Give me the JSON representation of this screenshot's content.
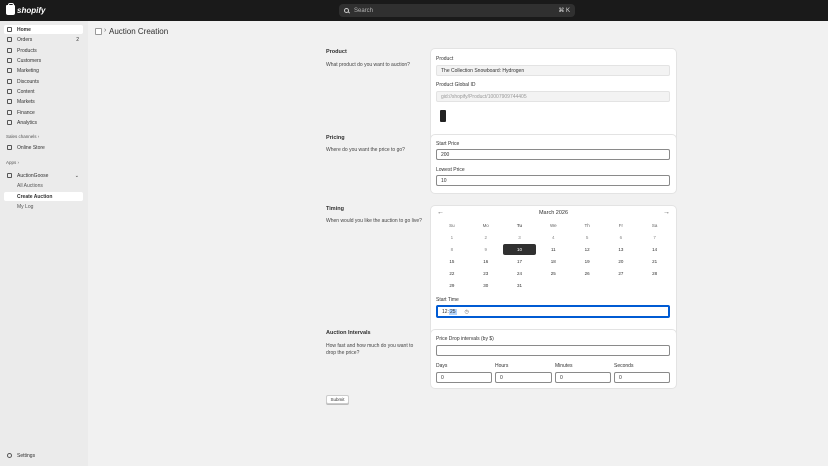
{
  "topbar": {
    "logo_text": "shopify",
    "search_placeholder": "Search",
    "shortcut": "⌘ K"
  },
  "sidebar": {
    "items": [
      {
        "label": "Home",
        "icon": "home-icon"
      },
      {
        "label": "Orders",
        "icon": "orders-icon",
        "badge": "2"
      },
      {
        "label": "Products",
        "icon": "products-icon"
      },
      {
        "label": "Customers",
        "icon": "customers-icon"
      },
      {
        "label": "Marketing",
        "icon": "marketing-icon"
      },
      {
        "label": "Discounts",
        "icon": "discounts-icon"
      },
      {
        "label": "Content",
        "icon": "content-icon"
      },
      {
        "label": "Markets",
        "icon": "markets-icon"
      },
      {
        "label": "Finance",
        "icon": "finance-icon"
      },
      {
        "label": "Analytics",
        "icon": "analytics-icon"
      }
    ],
    "sales_channels_label": "Sales channels",
    "online_store_label": "Online Store",
    "apps_label": "Apps",
    "app_name": "AuctionGoose",
    "app_subitems": [
      "All Auctions",
      "Create Auction",
      "My Log"
    ],
    "settings_label": "Settings"
  },
  "page": {
    "title": "Auction Creation"
  },
  "product_section": {
    "heading": "Product",
    "description": "What product do you want to auction?",
    "product_label": "Product",
    "product_value": "The Collection Snowboard: Hydrogen",
    "gid_label": "Product Global ID",
    "gid_value": "gid://shopify/Product/10007909744405"
  },
  "pricing_section": {
    "heading": "Pricing",
    "description": "Where do you want the price to go?",
    "start_label": "Start Price",
    "start_value": "200",
    "lowest_label": "Lowest Price",
    "lowest_value": "10"
  },
  "timing_section": {
    "heading": "Timing",
    "description": "When would you like the auction to go live?",
    "month": "March 2026",
    "weekdays": [
      "Su",
      "Mo",
      "Tu",
      "We",
      "Th",
      "Fr",
      "Sa"
    ],
    "weeks": [
      [
        "1",
        "2",
        "3",
        "4",
        "5",
        "6",
        "7"
      ],
      [
        "8",
        "9",
        "10",
        "11",
        "12",
        "13",
        "14"
      ],
      [
        "15",
        "16",
        "17",
        "18",
        "19",
        "20",
        "21"
      ],
      [
        "22",
        "23",
        "24",
        "25",
        "26",
        "27",
        "28"
      ],
      [
        "29",
        "30",
        "31",
        "",
        "",
        "",
        ""
      ]
    ],
    "selected_day": "10",
    "start_time_label": "Start Time",
    "time_hour": "12",
    "time_minute": "25"
  },
  "intervals_section": {
    "heading": "Auction Intervals",
    "description": "How fast and how much do you want to drop the price?",
    "price_drop_label": "Price Drop intervals (by $)",
    "price_drop_value": "",
    "days_label": "Days",
    "days_value": "0",
    "hours_label": "Hours",
    "hours_value": "0",
    "minutes_label": "Minutes",
    "minutes_value": "0",
    "seconds_label": "Seconds",
    "seconds_value": "0"
  },
  "submit_label": "Submit"
}
